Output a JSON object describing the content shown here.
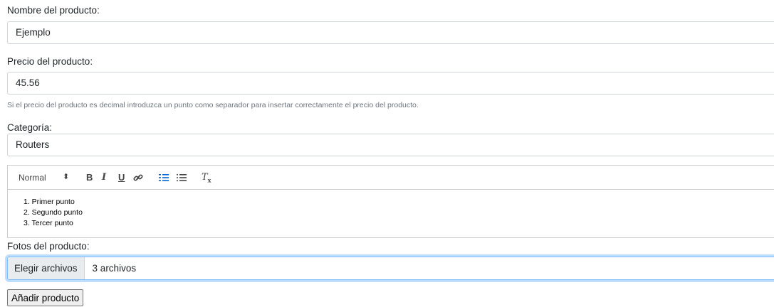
{
  "form": {
    "name_label": "Nombre del producto:",
    "name_value": "Ejemplo",
    "price_label": "Precio del producto:",
    "price_value": "45.56",
    "price_help": "Si el precio del producto es decimal introduzca un punto como separador para insertar correctamente el precio del producto.",
    "category_label": "Categoría:",
    "category_value": "Routers",
    "editor": {
      "toolbar": {
        "heading": "Normal",
        "arrows": "⬍",
        "bold": "B",
        "italic": "I",
        "underline": "U",
        "clean": "T",
        "clean_sub": "x"
      },
      "list": [
        "1. Primer punto",
        "2. Segundo punto",
        "3. Tercer punto"
      ]
    },
    "photos_label": "Fotos del producto:",
    "file_button": "Elegir archivos",
    "file_name": "3 archivos",
    "submit_label": "Añadir producto"
  },
  "colors": {
    "active_toolbar_icon": "#06c",
    "focus_border": "#80bdff"
  },
  "icons": {
    "link": "link-icon",
    "ordered_list": "ordered-list-icon",
    "bullet_list": "bullet-list-icon",
    "clean": "clear-format-icon"
  }
}
